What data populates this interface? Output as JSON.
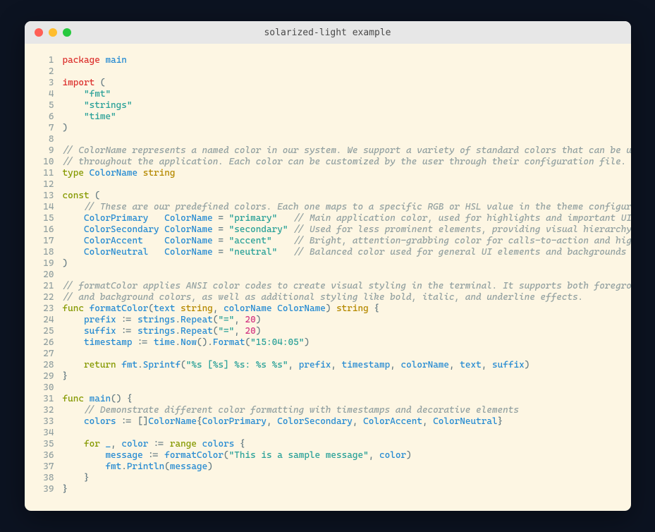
{
  "window": {
    "title": "solarized-light example"
  },
  "ln": {
    "1": "1",
    "2": "2",
    "3": "3",
    "4": "4",
    "5": "5",
    "6": "6",
    "7": "7",
    "8": "8",
    "9": "9",
    "10": "10",
    "11": "11",
    "12": "12",
    "13": "13",
    "14": "14",
    "15": "15",
    "16": "16",
    "17": "17",
    "18": "18",
    "19": "19",
    "20": "20",
    "21": "21",
    "22": "22",
    "23": "23",
    "24": "24",
    "25": "25",
    "26": "26",
    "27": "27",
    "28": "28",
    "29": "29",
    "30": "30",
    "31": "31",
    "32": "32",
    "33": "33",
    "34": "34",
    "35": "35",
    "36": "36",
    "37": "37",
    "38": "38",
    "39": "39"
  },
  "t": {
    "package": "package",
    "main": "main",
    "import": "import",
    "lparen": "(",
    "rparen": ")",
    "fmt": "\"fmt\"",
    "strings": "\"strings\"",
    "time": "\"time\"",
    "c_colorname1": "// ColorName represents a named color in our system. We support a variety of standard colors that can be used",
    "c_colorname2": "// throughout the application. Each color can be customized by the user through their configuration file.",
    "type": "type",
    "ColorName": "ColorName",
    "string": "string",
    "const": "const",
    "c_predefined": "// These are our predefined colors. Each one maps to a specific RGB or HSL value in the theme configuration.",
    "ColorPrimary": "ColorPrimary",
    "ColorSecondary": "ColorSecondary",
    "ColorAccent": "ColorAccent",
    "ColorNeutral": "ColorNeutral",
    "eq": "=",
    "colon_eq": ":=",
    "s_primary": "\"primary\"",
    "s_secondary": "\"secondary\"",
    "s_accent": "\"accent\"",
    "s_neutral": "\"neutral\"",
    "c_primary": "// Main application color, used for highlights and important UI elements",
    "c_secondary": "// Used for less prominent elements, providing visual hierarchy",
    "c_accent": "// Bright, attention-grabbing color for calls-to-action and highlights",
    "c_neutral": "// Balanced color used for general UI elements and backgrounds",
    "c_fc1": "// formatColor applies ANSI color codes to create visual styling in the terminal. It supports both foreground",
    "c_fc2": "// and background colors, as well as additional styling like bold, italic, and underline effects.",
    "func": "func",
    "formatColor": "formatColor",
    "text": "text",
    "colorName": "colorName",
    "lbrace": "{",
    "rbrace": "}",
    "comma": ",",
    "dot": ".",
    "prefix": "prefix",
    "suffix": "suffix",
    "timestamp": "timestamp",
    "stringsRepeat": "Repeat",
    "stringsPkg": "strings",
    "timePkg": "time",
    "Now": "Now",
    "Format": "Format",
    "s_eq": "\"=\"",
    "n20": "20",
    "s_timefmt": "\"15:04:05\"",
    "return": "return",
    "fmtPkg": "fmt",
    "Sprintf": "Sprintf",
    "s_fmtstr": "\"%s [%s] %s: %s %s\"",
    "c_demo": "// Demonstrate different color formatting with timestamps and decorative elements",
    "colors": "colors",
    "lbracket": "[",
    "rbracket": "]",
    "for": "for",
    "underscore": "_",
    "color": "color",
    "range": "range",
    "message": "message",
    "s_sample": "\"This is a sample message\"",
    "Println": "Println"
  }
}
